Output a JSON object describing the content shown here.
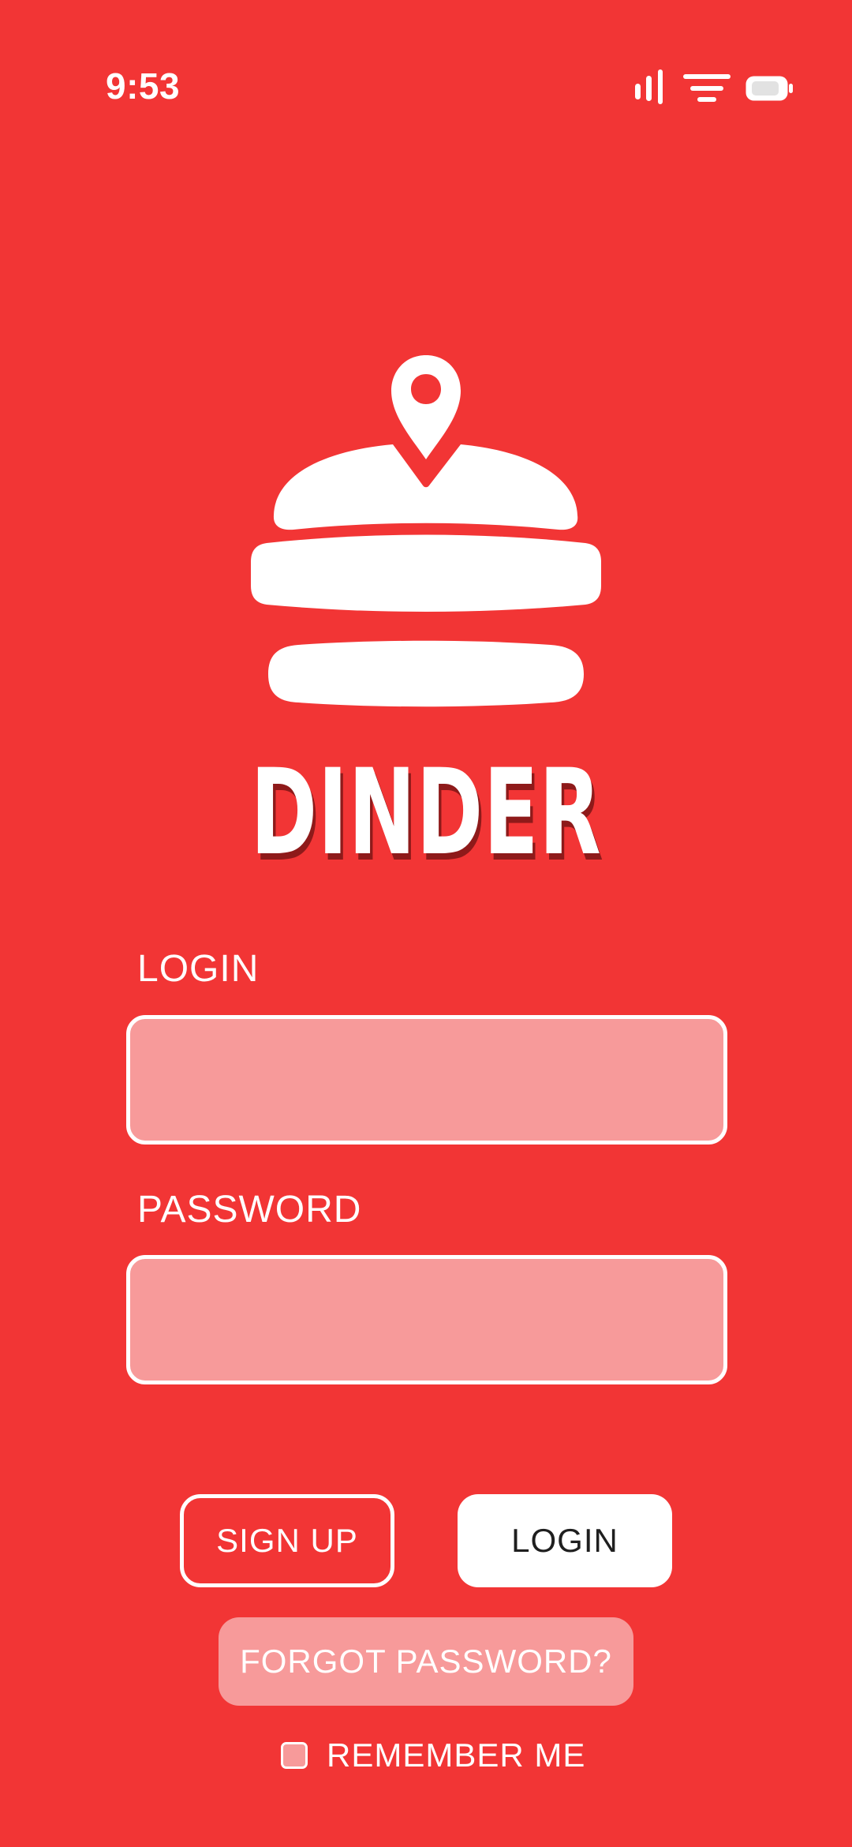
{
  "status_bar": {
    "time": "9:53",
    "icons": [
      "signal-icon",
      "wifi-icon",
      "battery-icon"
    ]
  },
  "brand": {
    "logo_icon": "burger-location-pin-icon",
    "name": "DINDER"
  },
  "form": {
    "login_label": "LOGIN",
    "login_value": "",
    "login_placeholder": "",
    "password_label": "PASSWORD",
    "password_value": "",
    "password_placeholder": ""
  },
  "actions": {
    "signup_label": "SIGN UP",
    "login_label": "LOGIN",
    "forgot_label": "FORGOT PASSWORD?",
    "remember_label": "REMEMBER ME",
    "remember_checked": false
  },
  "colors": {
    "background": "#F23535",
    "field_fill": "#F79A9A",
    "text_light": "#FFFFFF",
    "text_dark": "#1F1F1F",
    "title_shadow": "#8E1A1A"
  }
}
